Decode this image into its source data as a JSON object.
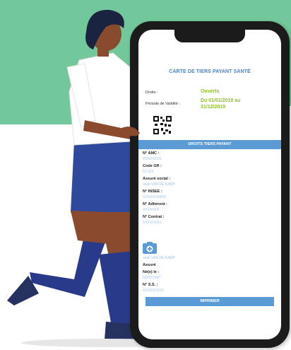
{
  "card": {
    "title": "CARTE DE TIERS PAYANT SANTÉ",
    "droits_label": "Droits :",
    "droits_value": "Ouverts",
    "periode_label": "Période de Validité :",
    "periode_value_1": "Du 01/01/2019 au",
    "periode_value_2": "31/12/2019",
    "section_button": "DROITS TIERS PAYANT",
    "fields": [
      {
        "label": "N° AMC :",
        "value": "XXXXXXXX"
      },
      {
        "label": "Code GR :",
        "value": "01 123"
      },
      {
        "label": "Assuré social :",
        "value": "Jean VAN DE KAMP"
      },
      {
        "label": "N° INSEE :",
        "value": "XXXXXXXXXX"
      },
      {
        "label": "N° Adhérent :",
        "value": "XXXXXXX"
      },
      {
        "label": "N° Contrat :",
        "value": "XXXXXXXX"
      }
    ],
    "beneficiary": {
      "name": "Jean VAN DE KAMP",
      "role": "Assuré",
      "birth_label": "Né(e) le :",
      "birth_value": "02/02/1960",
      "ss_label": "N° S.S. :",
      "ss_value": "XXXXXXXXX"
    },
    "print_button": "IMPRIMER"
  },
  "colors": {
    "background_band": "#72c89a",
    "accent_blue": "#5b9bd5",
    "title_blue": "#4a83c3",
    "value_green": "#8fbf2a"
  }
}
